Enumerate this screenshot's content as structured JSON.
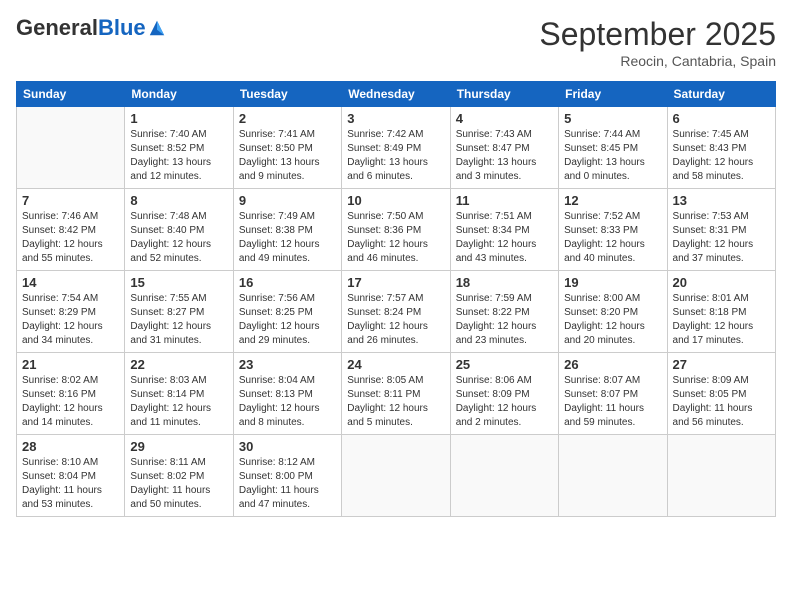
{
  "logo": {
    "general": "General",
    "blue": "Blue"
  },
  "header": {
    "month": "September 2025",
    "location": "Reocin, Cantabria, Spain"
  },
  "weekdays": [
    "Sunday",
    "Monday",
    "Tuesday",
    "Wednesday",
    "Thursday",
    "Friday",
    "Saturday"
  ],
  "weeks": [
    [
      {
        "day": "",
        "info": ""
      },
      {
        "day": "1",
        "info": "Sunrise: 7:40 AM\nSunset: 8:52 PM\nDaylight: 13 hours\nand 12 minutes."
      },
      {
        "day": "2",
        "info": "Sunrise: 7:41 AM\nSunset: 8:50 PM\nDaylight: 13 hours\nand 9 minutes."
      },
      {
        "day": "3",
        "info": "Sunrise: 7:42 AM\nSunset: 8:49 PM\nDaylight: 13 hours\nand 6 minutes."
      },
      {
        "day": "4",
        "info": "Sunrise: 7:43 AM\nSunset: 8:47 PM\nDaylight: 13 hours\nand 3 minutes."
      },
      {
        "day": "5",
        "info": "Sunrise: 7:44 AM\nSunset: 8:45 PM\nDaylight: 13 hours\nand 0 minutes."
      },
      {
        "day": "6",
        "info": "Sunrise: 7:45 AM\nSunset: 8:43 PM\nDaylight: 12 hours\nand 58 minutes."
      }
    ],
    [
      {
        "day": "7",
        "info": "Sunrise: 7:46 AM\nSunset: 8:42 PM\nDaylight: 12 hours\nand 55 minutes."
      },
      {
        "day": "8",
        "info": "Sunrise: 7:48 AM\nSunset: 8:40 PM\nDaylight: 12 hours\nand 52 minutes."
      },
      {
        "day": "9",
        "info": "Sunrise: 7:49 AM\nSunset: 8:38 PM\nDaylight: 12 hours\nand 49 minutes."
      },
      {
        "day": "10",
        "info": "Sunrise: 7:50 AM\nSunset: 8:36 PM\nDaylight: 12 hours\nand 46 minutes."
      },
      {
        "day": "11",
        "info": "Sunrise: 7:51 AM\nSunset: 8:34 PM\nDaylight: 12 hours\nand 43 minutes."
      },
      {
        "day": "12",
        "info": "Sunrise: 7:52 AM\nSunset: 8:33 PM\nDaylight: 12 hours\nand 40 minutes."
      },
      {
        "day": "13",
        "info": "Sunrise: 7:53 AM\nSunset: 8:31 PM\nDaylight: 12 hours\nand 37 minutes."
      }
    ],
    [
      {
        "day": "14",
        "info": "Sunrise: 7:54 AM\nSunset: 8:29 PM\nDaylight: 12 hours\nand 34 minutes."
      },
      {
        "day": "15",
        "info": "Sunrise: 7:55 AM\nSunset: 8:27 PM\nDaylight: 12 hours\nand 31 minutes."
      },
      {
        "day": "16",
        "info": "Sunrise: 7:56 AM\nSunset: 8:25 PM\nDaylight: 12 hours\nand 29 minutes."
      },
      {
        "day": "17",
        "info": "Sunrise: 7:57 AM\nSunset: 8:24 PM\nDaylight: 12 hours\nand 26 minutes."
      },
      {
        "day": "18",
        "info": "Sunrise: 7:59 AM\nSunset: 8:22 PM\nDaylight: 12 hours\nand 23 minutes."
      },
      {
        "day": "19",
        "info": "Sunrise: 8:00 AM\nSunset: 8:20 PM\nDaylight: 12 hours\nand 20 minutes."
      },
      {
        "day": "20",
        "info": "Sunrise: 8:01 AM\nSunset: 8:18 PM\nDaylight: 12 hours\nand 17 minutes."
      }
    ],
    [
      {
        "day": "21",
        "info": "Sunrise: 8:02 AM\nSunset: 8:16 PM\nDaylight: 12 hours\nand 14 minutes."
      },
      {
        "day": "22",
        "info": "Sunrise: 8:03 AM\nSunset: 8:14 PM\nDaylight: 12 hours\nand 11 minutes."
      },
      {
        "day": "23",
        "info": "Sunrise: 8:04 AM\nSunset: 8:13 PM\nDaylight: 12 hours\nand 8 minutes."
      },
      {
        "day": "24",
        "info": "Sunrise: 8:05 AM\nSunset: 8:11 PM\nDaylight: 12 hours\nand 5 minutes."
      },
      {
        "day": "25",
        "info": "Sunrise: 8:06 AM\nSunset: 8:09 PM\nDaylight: 12 hours\nand 2 minutes."
      },
      {
        "day": "26",
        "info": "Sunrise: 8:07 AM\nSunset: 8:07 PM\nDaylight: 11 hours\nand 59 minutes."
      },
      {
        "day": "27",
        "info": "Sunrise: 8:09 AM\nSunset: 8:05 PM\nDaylight: 11 hours\nand 56 minutes."
      }
    ],
    [
      {
        "day": "28",
        "info": "Sunrise: 8:10 AM\nSunset: 8:04 PM\nDaylight: 11 hours\nand 53 minutes."
      },
      {
        "day": "29",
        "info": "Sunrise: 8:11 AM\nSunset: 8:02 PM\nDaylight: 11 hours\nand 50 minutes."
      },
      {
        "day": "30",
        "info": "Sunrise: 8:12 AM\nSunset: 8:00 PM\nDaylight: 11 hours\nand 47 minutes."
      },
      {
        "day": "",
        "info": ""
      },
      {
        "day": "",
        "info": ""
      },
      {
        "day": "",
        "info": ""
      },
      {
        "day": "",
        "info": ""
      }
    ]
  ]
}
